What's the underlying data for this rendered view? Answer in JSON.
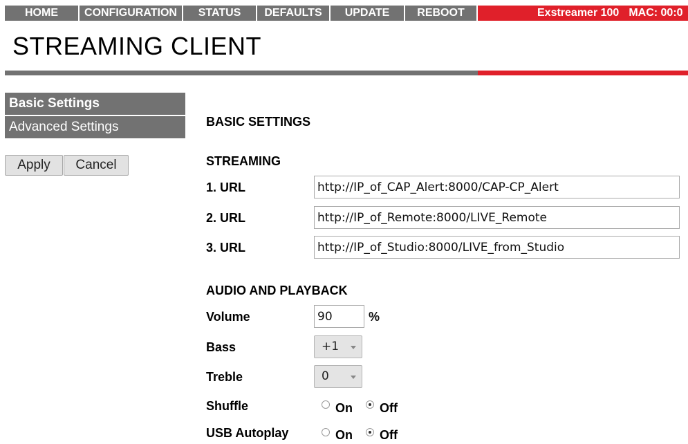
{
  "nav": {
    "items": [
      {
        "label": "HOME"
      },
      {
        "label": "CONFIGURATION"
      },
      {
        "label": "STATUS"
      },
      {
        "label": "DEFAULTS"
      },
      {
        "label": "UPDATE"
      },
      {
        "label": "REBOOT"
      }
    ],
    "device_name": "Exstreamer 100",
    "mac_label": "MAC: 00:0"
  },
  "page": {
    "title": "STREAMING CLIENT"
  },
  "sidebar": {
    "items": [
      {
        "label": "Basic Settings",
        "active": true
      },
      {
        "label": "Advanced Settings",
        "active": false
      }
    ],
    "apply_label": "Apply",
    "cancel_label": "Cancel"
  },
  "main": {
    "heading": "BASIC SETTINGS",
    "streaming": {
      "heading": "STREAMING",
      "urls": [
        {
          "label": "1. URL",
          "value": "http://IP_of_CAP_Alert:8000/CAP-CP_Alert"
        },
        {
          "label": "2. URL",
          "value": "http://IP_of_Remote:8000/LIVE_Remote"
        },
        {
          "label": "3. URL",
          "value": "http://IP_of_Studio:8000/LIVE_from_Studio"
        }
      ]
    },
    "audio": {
      "heading": "AUDIO AND PLAYBACK",
      "volume": {
        "label": "Volume",
        "value": "90",
        "unit": "%"
      },
      "bass": {
        "label": "Bass",
        "value": "+1"
      },
      "treble": {
        "label": "Treble",
        "value": "0"
      },
      "shuffle": {
        "label": "Shuffle",
        "on_label": "On",
        "off_label": "Off",
        "selected": "Off"
      },
      "usb_autoplay": {
        "label": "USB Autoplay",
        "on_label": "On",
        "off_label": "Off",
        "selected": "Off"
      }
    }
  },
  "colors": {
    "nav_gray": "#727272",
    "accent_red": "#e0202a"
  }
}
